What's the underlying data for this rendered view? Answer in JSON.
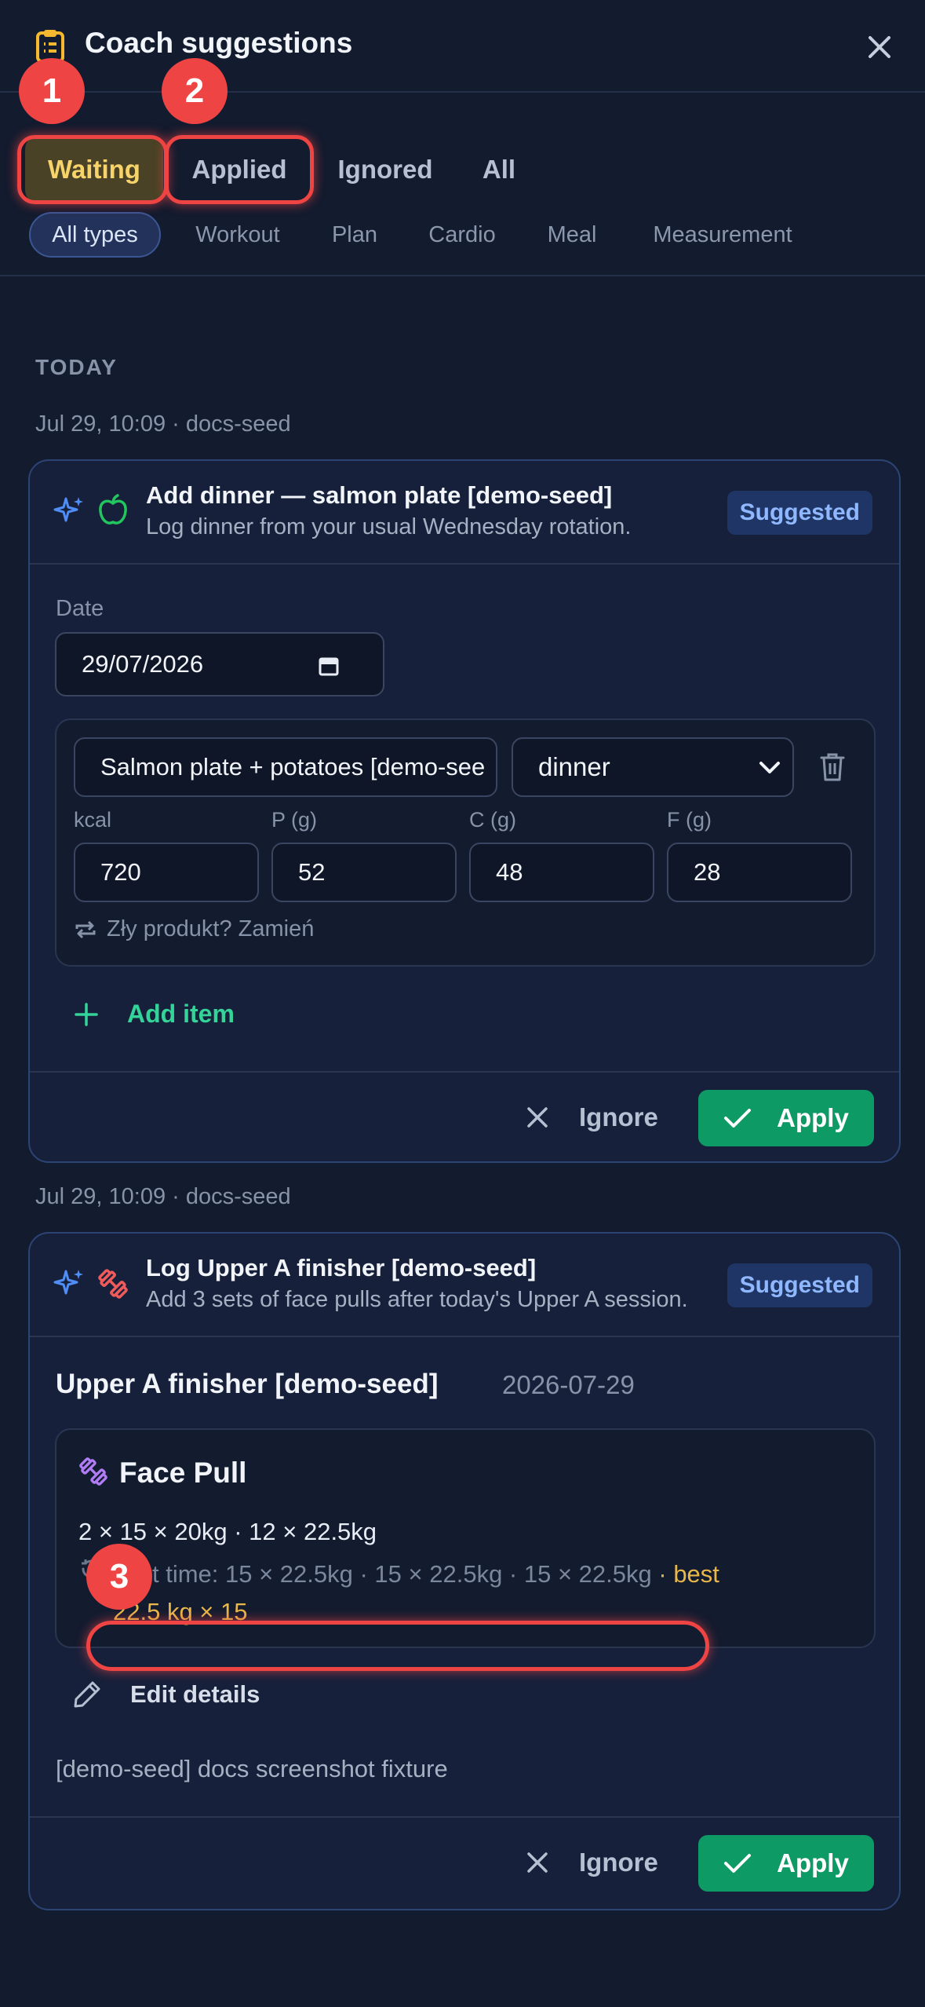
{
  "header": {
    "title": "Coach suggestions"
  },
  "tabs": [
    {
      "label": "Waiting",
      "active": true
    },
    {
      "label": "Applied",
      "active": false
    },
    {
      "label": "Ignored",
      "active": false
    },
    {
      "label": "All",
      "active": false
    }
  ],
  "filters": [
    "All types",
    "Workout",
    "Plan",
    "Cardio",
    "Meal",
    "Measurement"
  ],
  "markers": [
    "1",
    "2",
    "3"
  ],
  "section": {
    "label": "TODAY"
  },
  "suggestions": [
    {
      "meta": "Jul 29, 10:09 · docs-seed",
      "title": "Add dinner — salmon plate [demo-seed]",
      "subtitle": "Log dinner from your usual Wednesday rotation.",
      "badge": "Suggested",
      "date_label": "Date",
      "date_value": "29/07/2026",
      "item_name": "Salmon plate + potatoes [demo-seed]",
      "meal_type": "dinner",
      "macro_labels": [
        "kcal",
        "P (g)",
        "C (g)",
        "F (g)"
      ],
      "macro_values": [
        "720",
        "52",
        "48",
        "28"
      ],
      "swap_text": "Zły produkt? Zamień",
      "add_item": "Add item",
      "ignore": "Ignore",
      "apply": "Apply"
    },
    {
      "meta": "Jul 29, 10:09 · docs-seed",
      "title": "Log Upper A finisher [demo-seed]",
      "subtitle": "Add 3 sets of face pulls after today's Upper A session.",
      "badge": "Suggested",
      "workout_title": "Upper A finisher [demo-seed]",
      "workout_date": "2026-07-29",
      "exercise_name": "Face Pull",
      "sets": "2 × 15 × 20kg · 12 × 22.5kg",
      "last_time": "Last time: 15 × 22.5kg · 15 × 22.5kg · 15 × 22.5kg",
      "best_1": " · best",
      "best_2": "22.5 kg × 15",
      "edit_details": "Edit details",
      "note": "[demo-seed] docs screenshot fixture",
      "ignore": "Ignore",
      "apply": "Apply"
    }
  ],
  "colors": {
    "accent_green": "#0e9a64",
    "badge_blue": "#8fb8ff",
    "waiting_gold": "#f6d46b",
    "annotation_red": "#ef4444"
  }
}
